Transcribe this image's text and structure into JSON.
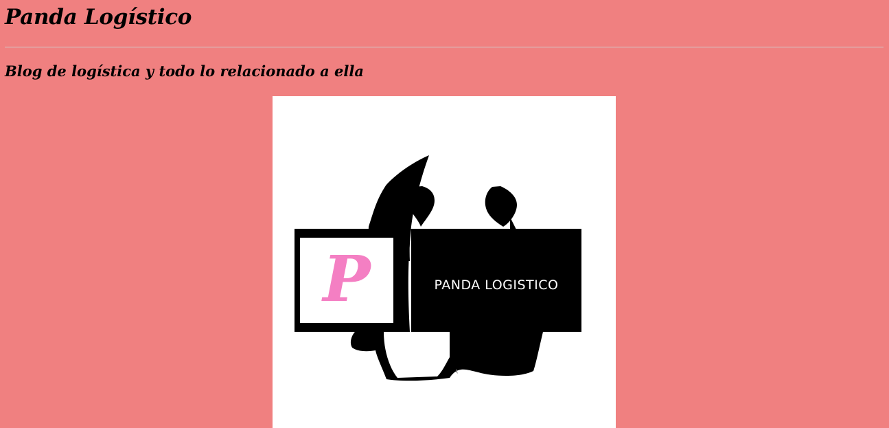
{
  "header": {
    "title": "Panda Logístico",
    "subtitle": "Blog de logística y todo lo relacionado a ella"
  },
  "logo": {
    "letter": "P",
    "wordmark": "PANDA LOGISTICO",
    "icon": "panda-silhouette-logo",
    "colors": {
      "background": "#ffffff",
      "silhouette": "#000000",
      "letter": "#f47fc3"
    }
  },
  "theme": {
    "page_background": "#f08080",
    "divider": "#cfcfcf"
  }
}
